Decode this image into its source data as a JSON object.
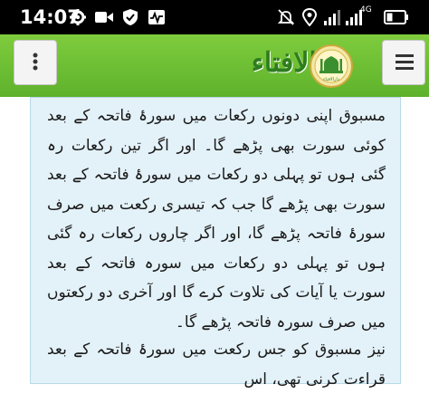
{
  "status_bar": {
    "time": "14:07",
    "network": "4G",
    "icons": [
      "gear-icon",
      "video-icon",
      "shield-icon",
      "activity-icon",
      "mute-icon",
      "location-icon",
      "signal-icon",
      "battery-icon"
    ]
  },
  "header": {
    "brand_name": "دارالافتاء",
    "logo_caption": "دارالافتاء",
    "left_button_icon": "more-vert-icon",
    "right_button_icon": "hamburger-icon"
  },
  "article": {
    "paragraph_1": "مسبوق اپنی دونوں رکعات میں سورۂ فاتحہ کے بعد کوئی سورت بھی پڑھے گا۔ اور اگر تین رکعات رہ گئی ہوں تو پہلی دو رکعات میں سورۂ فاتحہ کے بعد سورت بھی پڑھے گا جب کہ تیسری رکعت میں صرف سورۂ فاتحہ پڑھے گا، اور اگر چاروں رکعات رہ گئی ہوں تو پہلی دو رکعات میں سورہ فاتحہ کے بعد سورت یا آیات کی تلاوت کرے گا اور آخری دو رکعتوں میں صرف سورہ فاتحہ پڑھے گا۔",
    "paragraph_2": "نیز مسبوق کو جس رکعت میں سورۂ فاتحہ کے بعد قراءت کرنی تھی، اس"
  },
  "colors": {
    "header_green": "#6cbf33",
    "brand_green": "#2e7d1f",
    "card_bg": "#e3f1f8"
  }
}
